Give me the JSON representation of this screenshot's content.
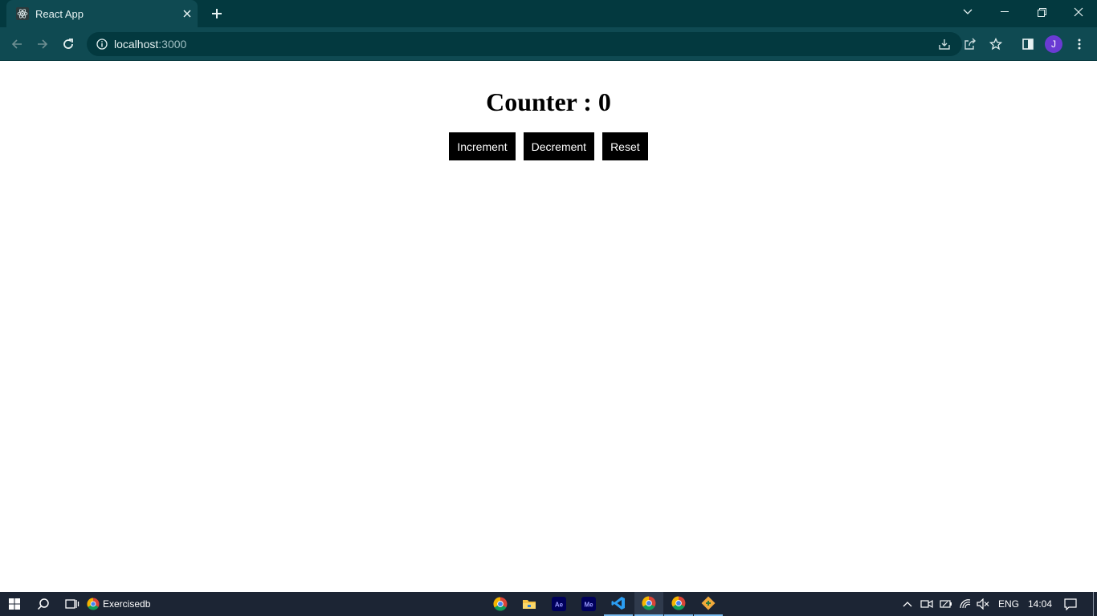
{
  "browser": {
    "tab": {
      "title": "React App",
      "favicon": "react-icon"
    },
    "address": {
      "host": "localhost",
      "port": ":3000"
    },
    "profile_initial": "J"
  },
  "app": {
    "title": "Counter : 0",
    "buttons": {
      "increment": "Increment",
      "decrement": "Decrement",
      "reset": "Reset"
    }
  },
  "taskbar": {
    "pinned_label": "Exercisedb",
    "language": "ENG",
    "time": "14:04",
    "apps": [
      "chrome-icon",
      "file-explorer-icon",
      "after-effects-icon",
      "media-encoder-icon",
      "vscode-icon",
      "chrome-icon",
      "chrome-icon",
      "git-icon"
    ]
  },
  "colors": {
    "titlebar": "#03393f",
    "toolbar": "#0f4a52",
    "taskbar": "#1c2534",
    "button": "#000000"
  }
}
